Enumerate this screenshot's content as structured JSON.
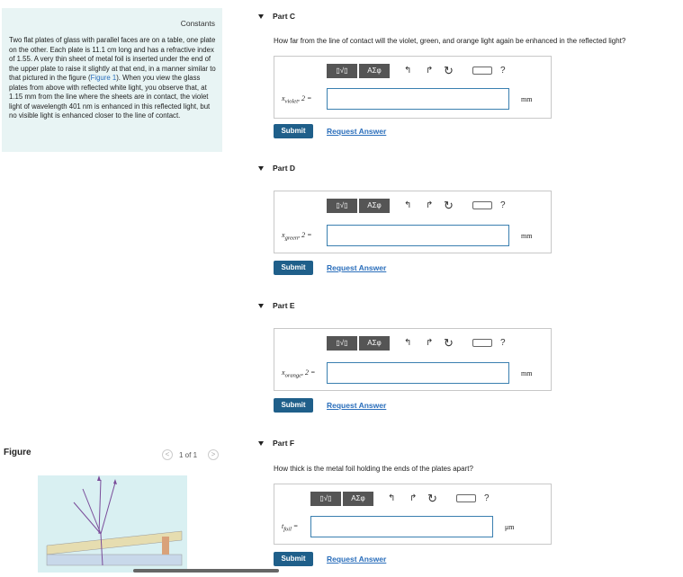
{
  "constants": {
    "title": "Constants",
    "problem_pre": "Two flat plates of glass with parallel faces are on a table, one plate on the other. Each plate is 11.1 cm long and has a refractive index of 1.55. A very thin sheet of metal foil is inserted under the end of the upper plate to raise it slightly at that end, in a manner similar to that pictured in the figure (",
    "problem_link": "Figure 1",
    "problem_post": "). When you view the glass plates from above with reflected white light, you observe that, at 1.15 mm from the line where the sheets are in contact, the violet light of wavelength 401 nm is enhanced in this reflected light, but no visible light is enhanced closer to the line of contact."
  },
  "figure": {
    "label": "Figure",
    "pager": "1 of 1",
    "prev": "<",
    "next": ">"
  },
  "toolbar": {
    "templates": "▯√▯",
    "greek": "ΑΣφ",
    "undo": "↰",
    "redo": "↱",
    "reset": "↻",
    "keyboard": "⌨",
    "help": "?"
  },
  "parts": [
    {
      "header": "Part C",
      "question": "How far from the line of contact will the violet, green, and orange light again be enhanced in the reflected light?",
      "var": "x",
      "sub": "violet",
      "suffix": ", 2 =",
      "unit": "mm",
      "submit": "Submit",
      "request": "Request Answer"
    },
    {
      "header": "Part D",
      "question": "",
      "var": "x",
      "sub": "green",
      "suffix": ", 2 =",
      "unit": "mm",
      "submit": "Submit",
      "request": "Request Answer"
    },
    {
      "header": "Part E",
      "question": "",
      "var": "x",
      "sub": "orange",
      "suffix": ", 2 =",
      "unit": "mm",
      "submit": "Submit",
      "request": "Request Answer"
    },
    {
      "header": "Part F",
      "question": "How thick is the metal foil holding the ends of the plates apart?",
      "var": "t",
      "sub": "foil",
      "suffix": " =",
      "unit": "μm",
      "submit": "Submit",
      "request": "Request Answer"
    }
  ]
}
